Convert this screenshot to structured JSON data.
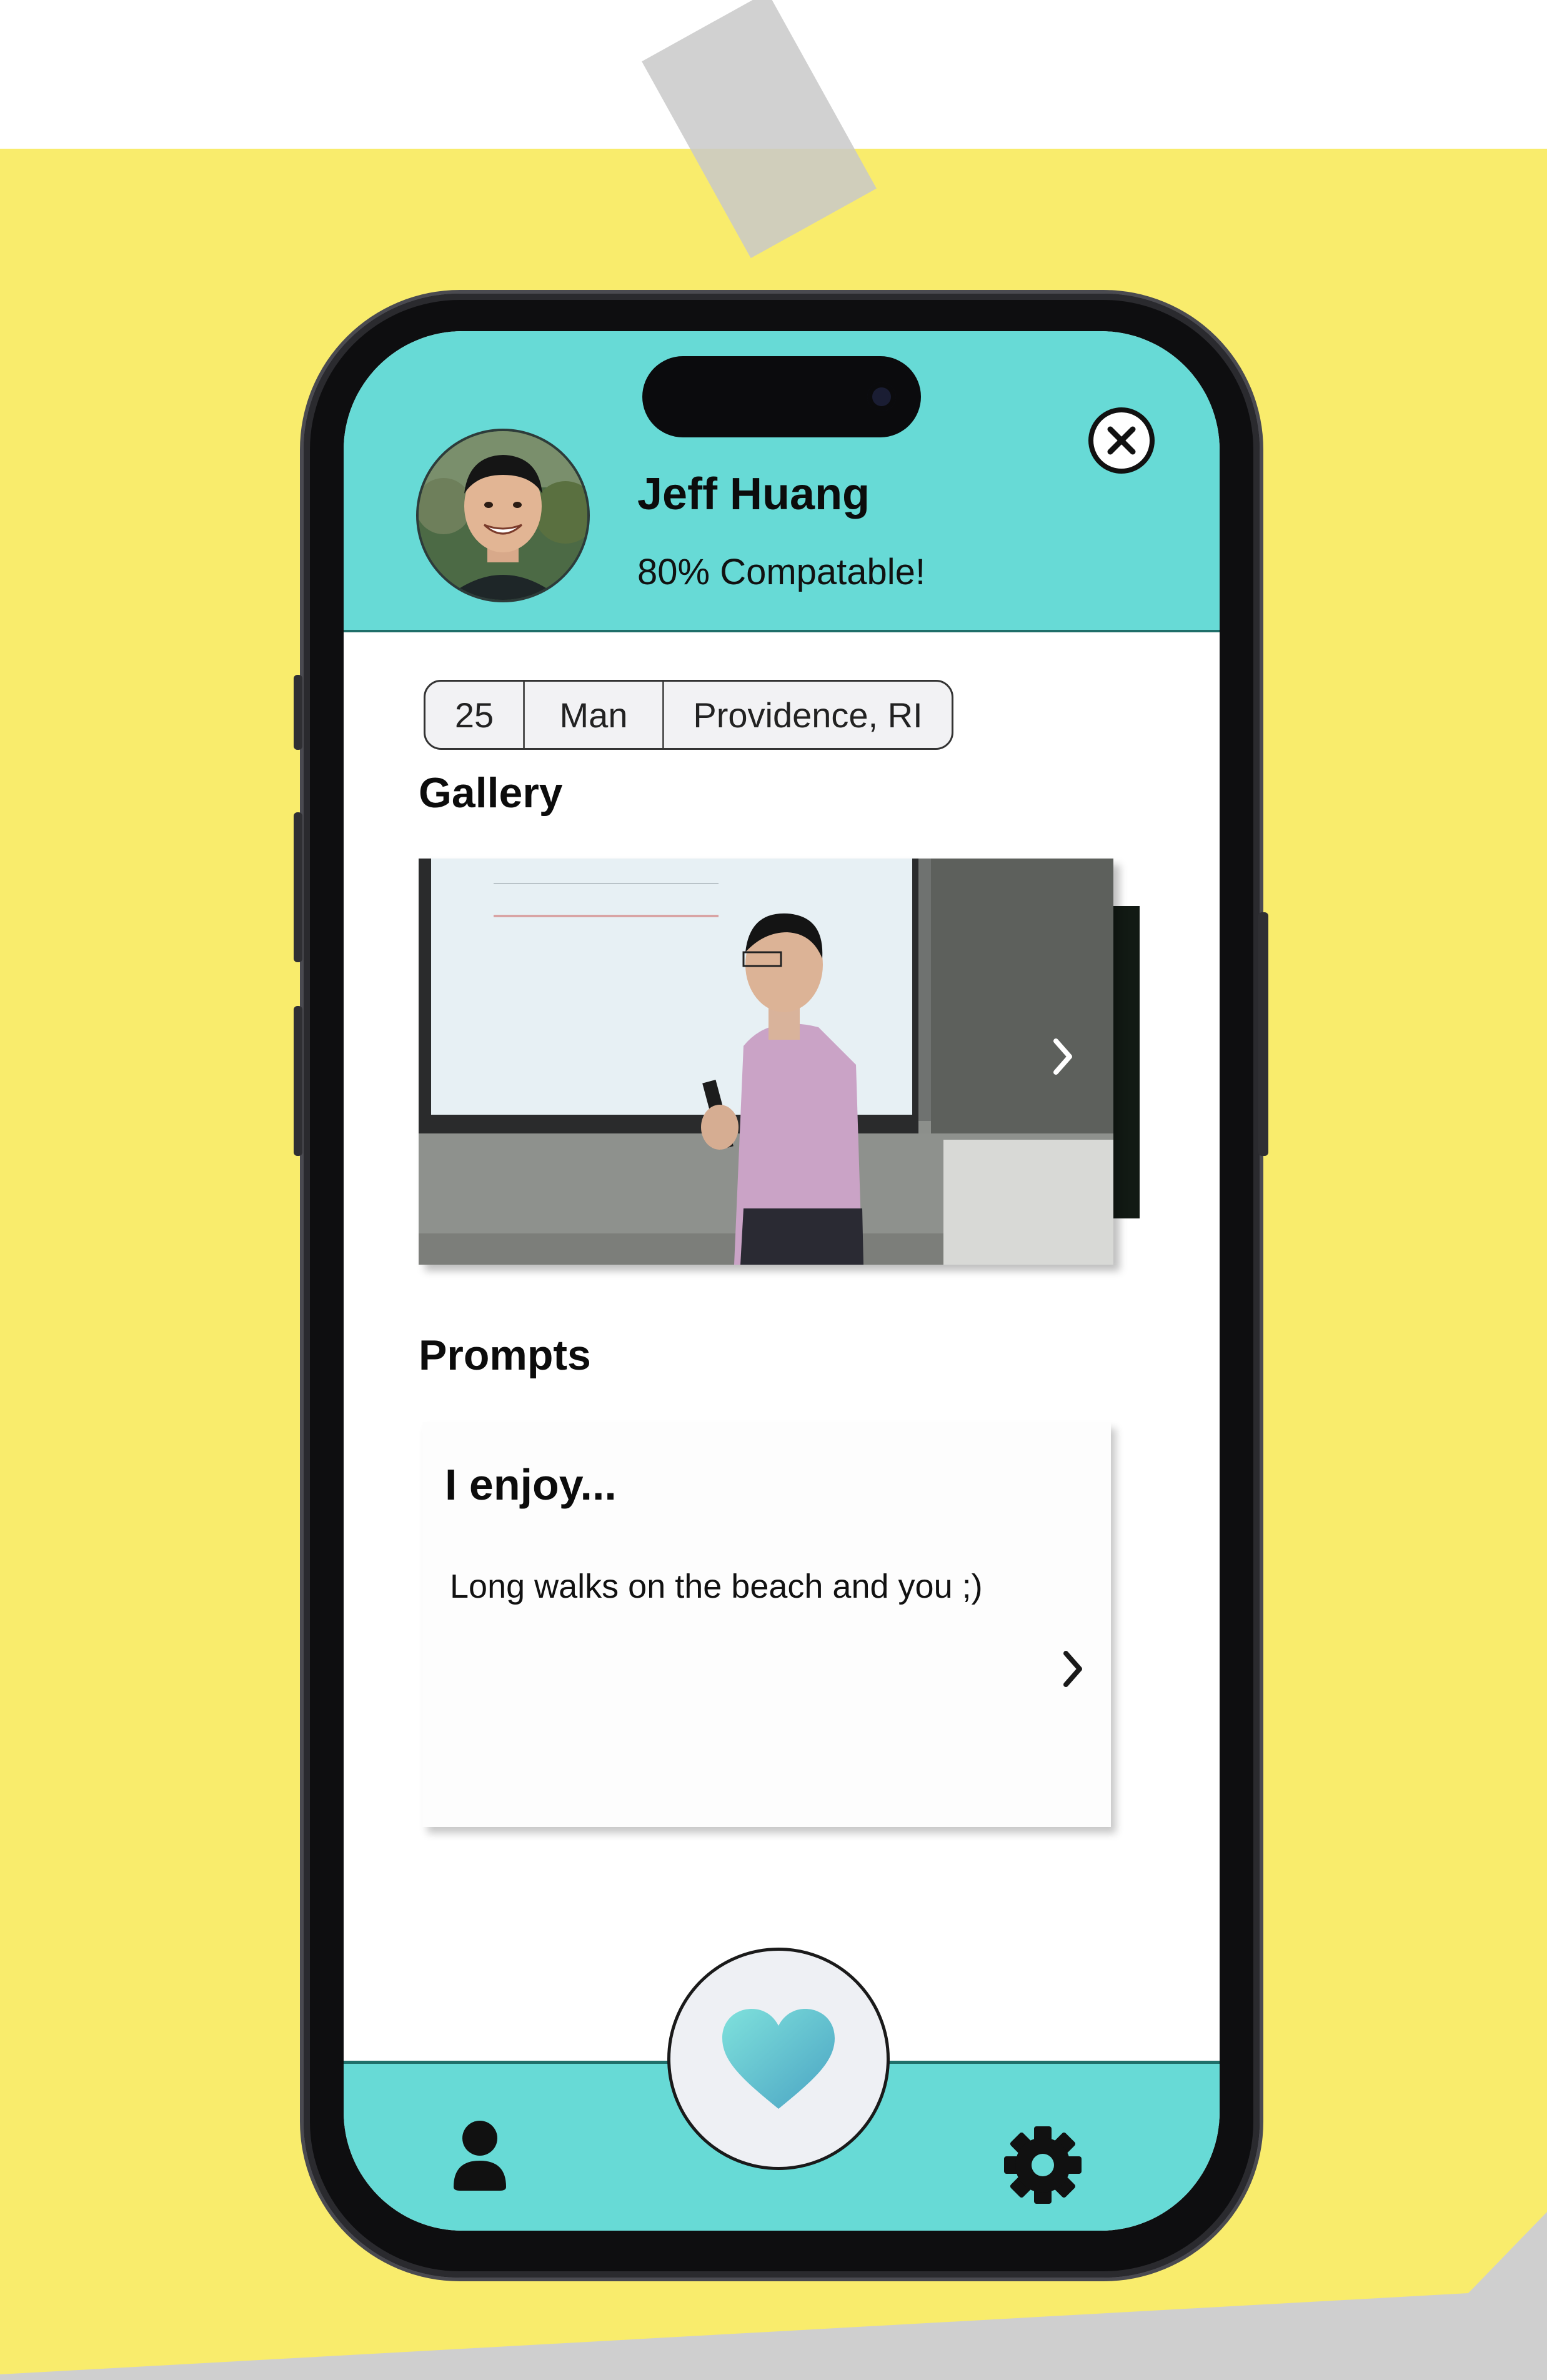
{
  "profile": {
    "name": "Jeff Huang",
    "compatibility": "80% Compatable!"
  },
  "details": [
    {
      "id": "age",
      "label": "25"
    },
    {
      "id": "gender",
      "label": "Man"
    },
    {
      "id": "location",
      "label": "Providence, RI"
    }
  ],
  "gallery": {
    "title": "Gallery"
  },
  "prompts": {
    "title": "Prompts",
    "items": [
      {
        "question": "I enjoy...",
        "answer": "Long walks on the beach and you ;)"
      }
    ]
  },
  "icons": {
    "close": "close-icon",
    "next": "chevron-right-icon",
    "like": "heart-icon",
    "profile": "person-icon",
    "settings": "gear-icon"
  },
  "colors": {
    "header_bg": "#67dad6",
    "background_paper": "#f9ec6c",
    "heart_gradient_start": "#7fe1dc",
    "heart_gradient_end": "#4aa3c3"
  }
}
